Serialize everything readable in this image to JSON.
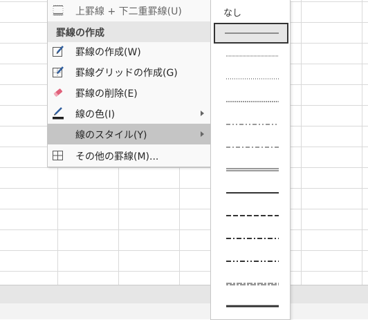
{
  "menu": {
    "items": [
      {
        "label": "上罫線 + 下二重罫線(U)",
        "icon": "top-double-bottom-border-icon"
      },
      {
        "label": "罫線の作成",
        "header": true
      },
      {
        "label": "罫線の作成(W)",
        "icon": "draw-border-icon"
      },
      {
        "label": "罫線グリッドの作成(G)",
        "icon": "draw-border-grid-icon"
      },
      {
        "label": "罫線の削除(E)",
        "icon": "erase-border-icon"
      },
      {
        "label": "線の色(I)",
        "icon": "line-color-icon",
        "submenu": true
      },
      {
        "label": "線のスタイル(Y)",
        "submenu": true,
        "active": true
      },
      {
        "label": "その他の罫線(M)...",
        "icon": "more-borders-icon"
      }
    ]
  },
  "line_style_menu": {
    "none_label": "なし",
    "styles": [
      {
        "name": "thin-solid",
        "selected": true
      },
      {
        "name": "hair-dotted"
      },
      {
        "name": "dotted"
      },
      {
        "name": "fine-dashed"
      },
      {
        "name": "dash-dot-dot"
      },
      {
        "name": "dash-dot"
      },
      {
        "name": "double"
      },
      {
        "name": "medium-solid"
      },
      {
        "name": "medium-dashed"
      },
      {
        "name": "medium-dash-dot"
      },
      {
        "name": "medium-dash-dot-dot"
      },
      {
        "name": "slant-dash-dot"
      },
      {
        "name": "thick-solid"
      }
    ]
  },
  "colors": {
    "active_item_bg": "#c5c5c5",
    "header_bg": "#e6e6e6",
    "line_color_swatch": "#1f1f1f",
    "erase_icon": "#e0617a",
    "pen_icon": "#2f5e9e"
  }
}
